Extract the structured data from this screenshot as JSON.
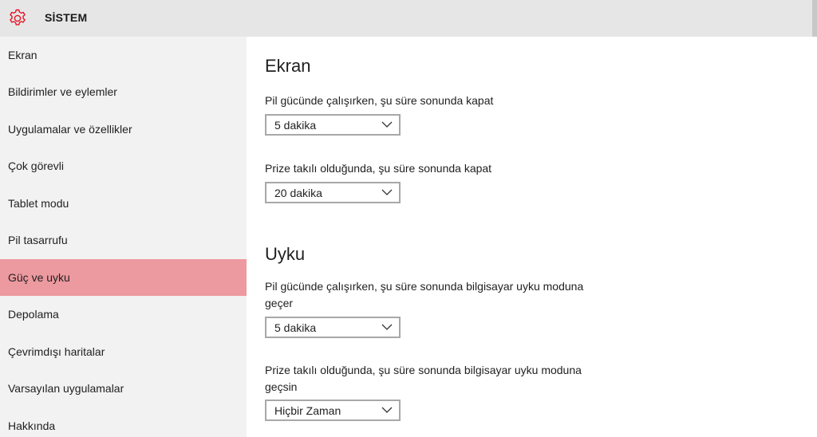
{
  "header": {
    "title": "SİSTEM",
    "icon": "gear-icon",
    "accent_color": "#e81123"
  },
  "sidebar": {
    "items": [
      {
        "label": "Ekran",
        "selected": false
      },
      {
        "label": "Bildirimler ve eylemler",
        "selected": false
      },
      {
        "label": "Uygulamalar ve özellikler",
        "selected": false
      },
      {
        "label": "Çok görevli",
        "selected": false
      },
      {
        "label": "Tablet modu",
        "selected": false
      },
      {
        "label": "Pil tasarrufu",
        "selected": false
      },
      {
        "label": "Güç ve uyku",
        "selected": true
      },
      {
        "label": "Depolama",
        "selected": false
      },
      {
        "label": "Çevrimdışı haritalar",
        "selected": false
      },
      {
        "label": "Varsayılan uygulamalar",
        "selected": false
      },
      {
        "label": "Hakkında",
        "selected": false
      }
    ],
    "selected_color": "#ec999f"
  },
  "main": {
    "screen": {
      "title": "Ekran",
      "battery_label": "Pil gücünde çalışırken, şu süre sonunda kapat",
      "battery_value": "5 dakika",
      "plugged_label": "Prize takılı olduğunda, şu süre sonunda kapat",
      "plugged_value": "20 dakika"
    },
    "sleep": {
      "title": "Uyku",
      "battery_label": "Pil gücünde çalışırken, şu süre sonunda bilgisayar uyku moduna geçer",
      "battery_value": "5 dakika",
      "plugged_label": "Prize takılı olduğunda, şu süre sonunda bilgisayar uyku moduna geçsin",
      "plugged_value": "Hiçbir Zaman"
    }
  }
}
